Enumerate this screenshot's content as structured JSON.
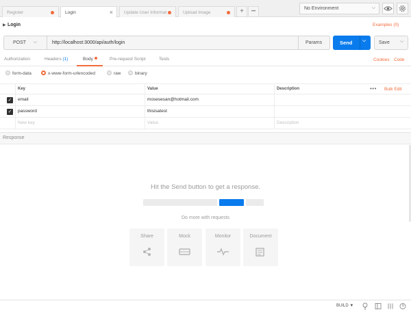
{
  "tabs": [
    {
      "label": "Register",
      "state": "unsaved"
    },
    {
      "label": "Login",
      "state": "active"
    },
    {
      "label": "Update User Informat",
      "state": "unsaved"
    },
    {
      "label": "Upload Image",
      "state": "unsaved"
    }
  ],
  "tab_actions": {
    "add": "+",
    "more": "•••"
  },
  "environment": {
    "selected": "No Environment"
  },
  "request": {
    "title": "Login",
    "examples_label": "Examples (0)",
    "method": "POST",
    "url": "http://localhost:3000/api/auth/login",
    "params_label": "Params",
    "send_label": "Send",
    "save_label": "Save"
  },
  "subtabs": {
    "authorization": "Authorization",
    "headers": "Headers",
    "headers_count": "(1)",
    "body": "Body",
    "pre_request": "Pre-request Script",
    "tests": "Tests",
    "active": "Body"
  },
  "links": {
    "cookies": "Cookies",
    "code": "Code"
  },
  "body_modes": {
    "options": [
      "form-data",
      "x-www-form-urlencoded",
      "raw",
      "binary"
    ],
    "selected": "x-www-form-urlencoded"
  },
  "kv_table": {
    "headers": {
      "key": "Key",
      "value": "Value",
      "description": "Description"
    },
    "bulk_edit": "Bulk Edit",
    "more": "•••",
    "rows": [
      {
        "checked": true,
        "key": "email",
        "value": "mosesesan@hotmail.com",
        "description": ""
      },
      {
        "checked": true,
        "key": "password",
        "value": "thisisatest",
        "description": ""
      }
    ],
    "placeholders": {
      "key": "New key",
      "value": "Value",
      "description": "Description"
    }
  },
  "response": {
    "header": "Response",
    "hint": "Hit the Send button to get a response.",
    "more": "Do more with requests",
    "cards": [
      "Share",
      "Mock",
      "Monitor",
      "Document"
    ]
  },
  "status_bar": {
    "build": "BUILD ▼"
  },
  "colors": {
    "accent": "#f26b3a",
    "primary": "#097bed"
  }
}
